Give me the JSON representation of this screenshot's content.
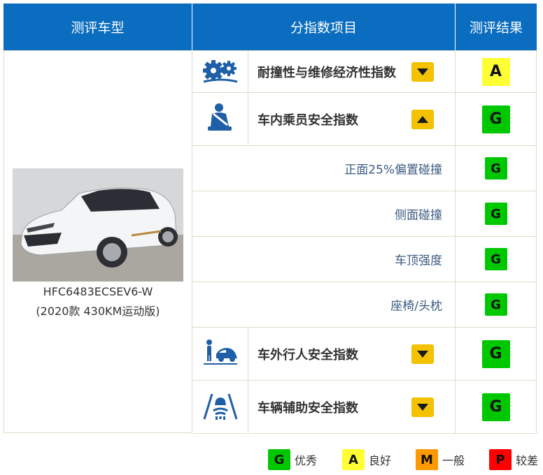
{
  "header": {
    "model": "测评车型",
    "item": "分指数项目",
    "result": "测评结果"
  },
  "model": {
    "code": "HFC6483ECSEV6-W",
    "version": "(2020款 430KM运动版)"
  },
  "indices": [
    {
      "label": "耐撞性与维修经济性指数",
      "icon": "repair-gears-icon",
      "arrow": "down",
      "grade": "A"
    },
    {
      "label": "车内乘员安全指数",
      "icon": "seated-occupant-seatbelt-icon",
      "arrow": "up",
      "grade": "G"
    },
    {
      "label": "车外行人安全指数",
      "icon": "pedestrian-car-icon",
      "arrow": "down",
      "grade": "G"
    },
    {
      "label": "车辆辅助安全指数",
      "icon": "lane-assist-icon",
      "arrow": "down",
      "grade": "G"
    }
  ],
  "sub_items": [
    {
      "label": "正面25%偏置碰撞",
      "grade": "G"
    },
    {
      "label": "侧面碰撞",
      "grade": "G"
    },
    {
      "label": "车顶强度",
      "grade": "G"
    },
    {
      "label": "座椅/头枕",
      "grade": "G"
    }
  ],
  "legend": [
    {
      "grade": "G",
      "label": "优秀",
      "color": "#00c800"
    },
    {
      "grade": "A",
      "label": "良好",
      "color": "#ffff33"
    },
    {
      "grade": "M",
      "label": "一般",
      "color": "#ff9900"
    },
    {
      "grade": "P",
      "label": "较差",
      "color": "#ff0000"
    }
  ],
  "colors": {
    "header_bg": "#0b6dbf",
    "arrow_button": "#f5c200",
    "icon_blue": "#1f5fa8",
    "grade_G": "#00c800",
    "grade_A": "#ffff33"
  }
}
